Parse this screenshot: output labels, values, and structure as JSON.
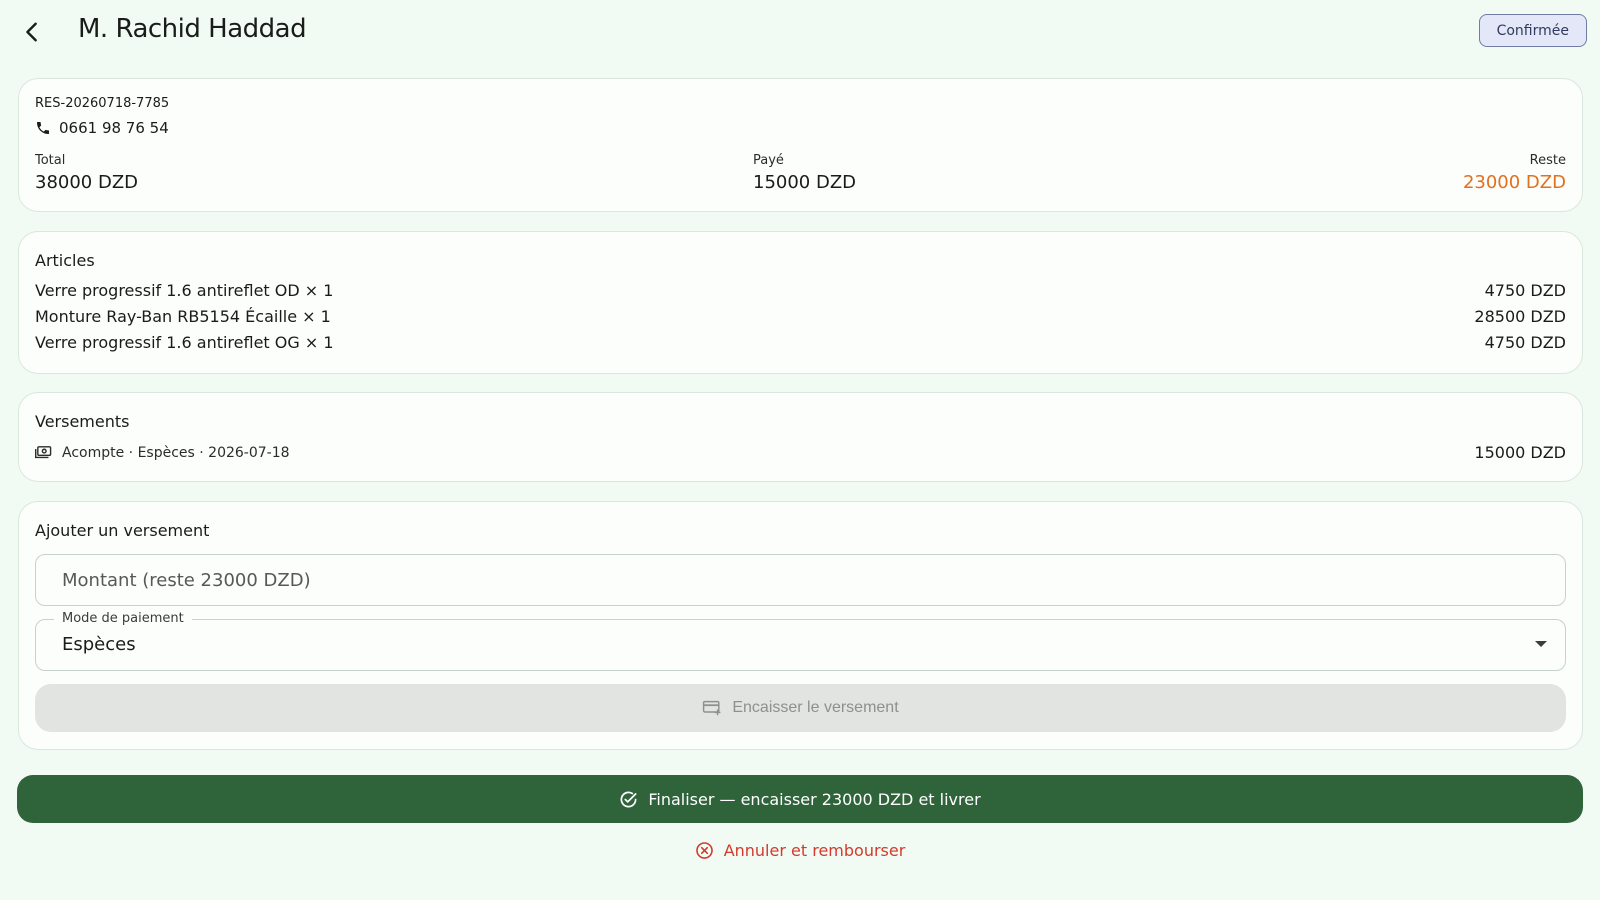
{
  "header": {
    "back_icon": "arrow-back-icon",
    "title": "M. Rachid Haddad",
    "status": "Confirmée"
  },
  "summary": {
    "reference": "RES-20260718-7785",
    "phone_icon": "phone-icon",
    "phone": "0661 98 76 54",
    "total_label": "Total",
    "total_value": "38000 DZD",
    "paid_label": "Payé",
    "paid_value": "15000 DZD",
    "rest_label": "Reste",
    "rest_value": "23000 DZD",
    "rest_color": "#e2701f"
  },
  "articles": {
    "title": "Articles",
    "items": [
      {
        "label": "Verre progressif 1.6 antireflet OD × 1",
        "amount": "4750 DZD"
      },
      {
        "label": "Monture Ray-Ban RB5154 Écaille × 1",
        "amount": "28500 DZD"
      },
      {
        "label": "Verre progressif 1.6 antireflet OG × 1",
        "amount": "4750 DZD"
      }
    ]
  },
  "payments": {
    "title": "Versements",
    "items": [
      {
        "icon": "cash-icon",
        "label": "Acompte · Espèces · 2026-07-18",
        "amount": "15000 DZD"
      }
    ]
  },
  "add_payment": {
    "title": "Ajouter un versement",
    "amount_placeholder": "Montant (reste 23000 DZD)",
    "amount_value": "",
    "mode_label": "Mode de paiement",
    "mode_value": "Espèces",
    "submit_icon": "card-add-icon",
    "submit_label": "Encaisser le versement"
  },
  "actions": {
    "finalize_icon": "check-circle-icon",
    "finalize_label": "Finaliser — encaisser 23000 DZD et livrer",
    "cancel_icon": "cancel-circle-icon",
    "cancel_label": "Annuler et rembourser"
  },
  "colors": {
    "background": "#f1fbf3",
    "primary": "#2f6339",
    "danger": "#d33a2c",
    "warning": "#e2701f"
  }
}
